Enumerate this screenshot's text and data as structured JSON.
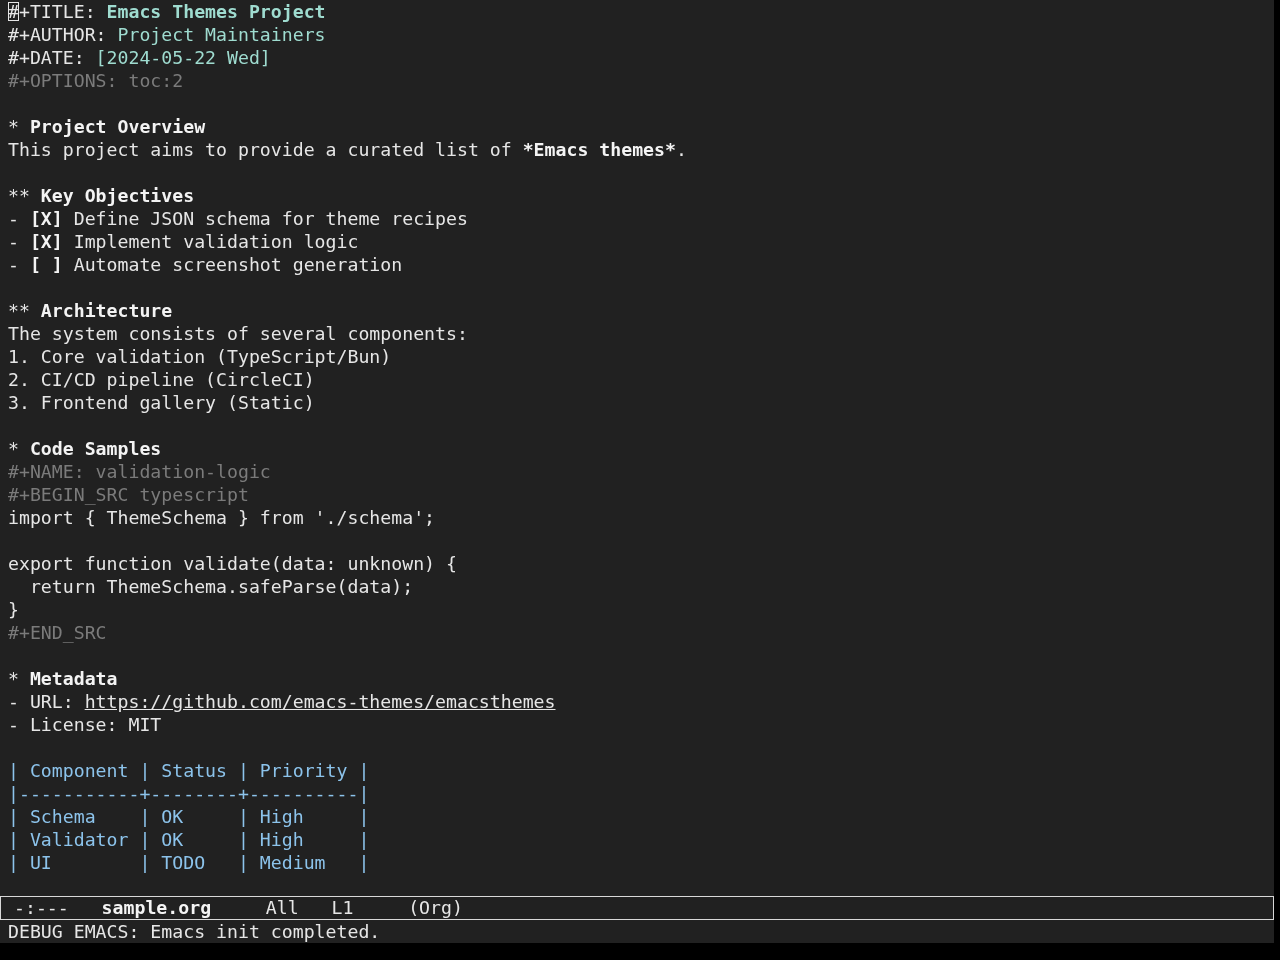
{
  "header": [
    {
      "kind": "document_title",
      "key": "#+TITLE:",
      "value": "Emacs Themes Project",
      "cursor": true
    },
    {
      "kind": "document_info",
      "key": "#+AUTHOR:",
      "value": "Project Maintainers",
      "cursor": false
    },
    {
      "kind": "document_info",
      "key": "#+DATE:",
      "value": "[2024-05-22 Wed]",
      "cursor": false
    },
    {
      "kind": "option",
      "key": "#+OPTIONS:",
      "value": "toc:2",
      "cursor": false
    }
  ],
  "sections": [
    {
      "marker": "*",
      "title": "Project Overview",
      "blocks": [
        [
          {
            "kind": "paragraph",
            "segments": [
              {
                "text": "This project aims to provide a curated list of ",
                "bold": false
              },
              {
                "text": "*Emacs themes*",
                "bold": true
              },
              {
                "text": ".",
                "bold": false
              }
            ]
          }
        ]
      ]
    },
    {
      "marker": "**",
      "title": "Key Objectives",
      "blocks": [
        [
          {
            "kind": "checkbox_item",
            "bullet": "-",
            "checkbox": "[X]",
            "text": "Define JSON schema for theme recipes"
          },
          {
            "kind": "checkbox_item",
            "bullet": "-",
            "checkbox": "[X]",
            "text": "Implement validation logic"
          },
          {
            "kind": "checkbox_item",
            "bullet": "-",
            "checkbox": "[ ]",
            "text": "Automate screenshot generation"
          }
        ]
      ]
    },
    {
      "marker": "**",
      "title": "Architecture",
      "blocks": [
        [
          {
            "kind": "paragraph",
            "segments": [
              {
                "text": "The system consists of several components:",
                "bold": false
              }
            ]
          },
          {
            "kind": "numbered_item",
            "number": "1.",
            "text": "Core validation (TypeScript/Bun)"
          },
          {
            "kind": "numbered_item",
            "number": "2.",
            "text": "CI/CD pipeline (CircleCI)"
          },
          {
            "kind": "numbered_item",
            "number": "3.",
            "text": "Frontend gallery (Static)"
          }
        ]
      ]
    },
    {
      "marker": "*",
      "title": "Code Samples",
      "blocks": [
        [
          {
            "kind": "src_block",
            "name": "#+NAME: validation-logic",
            "begin": "#+BEGIN_SRC typescript",
            "code": "import { ThemeSchema } from './schema';\n\nexport function validate(data: unknown) {\n  return ThemeSchema.safeParse(data);\n}",
            "end": "#+END_SRC"
          }
        ]
      ]
    },
    {
      "marker": "*",
      "title": "Metadata",
      "blocks": [
        [
          {
            "kind": "link_item",
            "bullet": "-",
            "label": "URL:",
            "value": "https://github.com/emacs-themes/emacsthemes"
          },
          {
            "kind": "field_item",
            "bullet": "-",
            "label": "License:",
            "value": "MIT"
          }
        ],
        [
          {
            "kind": "table_row",
            "text": "| Component | Status | Priority |"
          },
          {
            "kind": "table_rule",
            "text": "|-----------+--------+----------|"
          },
          {
            "kind": "table_row",
            "text": "| Schema    | OK     | High     |"
          },
          {
            "kind": "table_row",
            "text": "| Validator | OK     | High     |"
          },
          {
            "kind": "table_row",
            "text": "| UI        | TODO   | Medium   |"
          }
        ]
      ]
    }
  ],
  "mode_line": {
    "status": "-:---",
    "buffer_name": "sample.org",
    "position": "All",
    "line": "L1",
    "mode": "(Org)"
  },
  "echo_area": {
    "message": "DEBUG EMACS: Emacs init completed."
  }
}
